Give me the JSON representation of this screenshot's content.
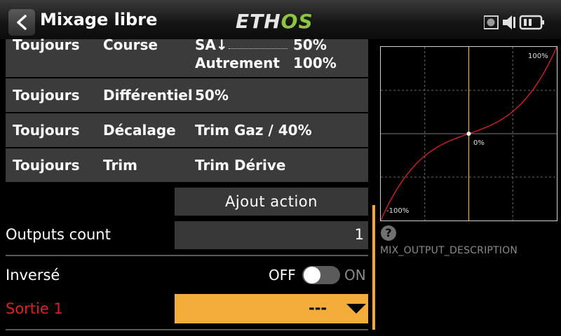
{
  "header": {
    "title": "Mixage libre",
    "logo_left": "ETH",
    "logo_right": "OS"
  },
  "actions": [
    {
      "cond": "Toujours",
      "type": "Course",
      "value": "SA↓",
      "value2": "50%"
    },
    {
      "cond": "",
      "type": "",
      "value": "Autrement",
      "value2": "100%"
    },
    {
      "cond": "Toujours",
      "type": "Différentiel",
      "value": "50%"
    },
    {
      "cond": "Toujours",
      "type": "Décalage",
      "value": "Trim Gaz / 40%"
    },
    {
      "cond": "Toujours",
      "type": "Trim",
      "value": "Trim Dérive"
    }
  ],
  "add_action_label": "Ajout action",
  "outputs_count": {
    "label": "Outputs count",
    "value": "1"
  },
  "inverse": {
    "label": "Inversé",
    "off": "OFF",
    "on": "ON",
    "state": "off"
  },
  "sortie": {
    "label": "Sortie 1",
    "value": "---"
  },
  "curve": {
    "label_top": "100%",
    "label_center": "0%",
    "label_bottom": "-100%"
  },
  "description": "MIX_OUTPUT_DESCRIPTION",
  "colors": {
    "accent": "#f4ad3a",
    "curve": "#d42020",
    "logo_green": "#8cc63f",
    "error_label": "#e02020"
  }
}
